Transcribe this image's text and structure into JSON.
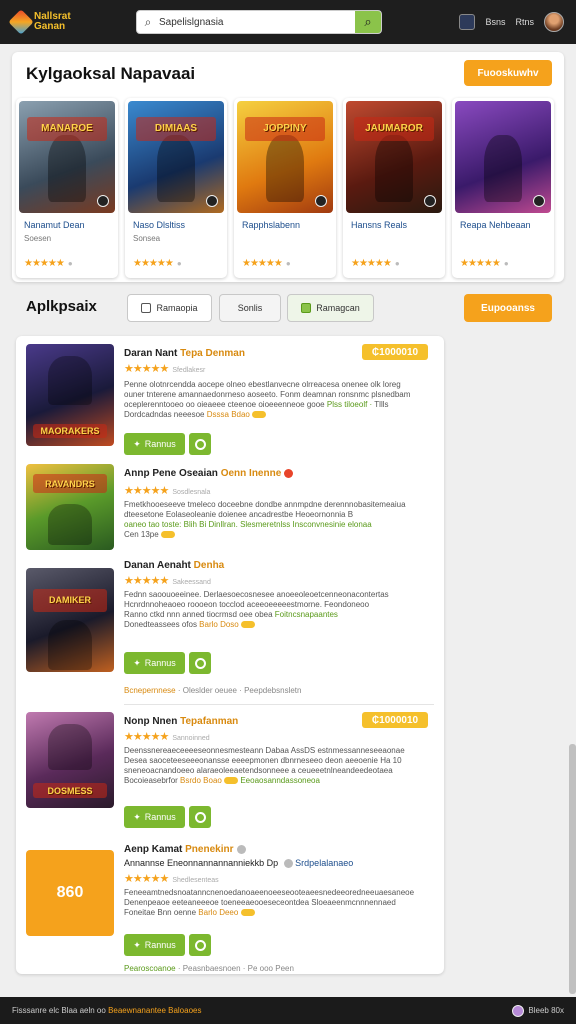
{
  "header": {
    "logo_text": "Nallsrat\nGanan",
    "search_placeholder": "Sapelislgnasia",
    "search_value": "Sapelislgnasia",
    "link_1": "Bsns",
    "link_2": "Rtns"
  },
  "featured": {
    "title": "Kylgaoksal Napavaai",
    "button": "Fuooskuwhv",
    "cards": [
      {
        "name": "Nanamut Dean",
        "sub": "Soesen",
        "banner": "MANAROE",
        "bg": "#5a6a7a",
        "stars": "★★★★★"
      },
      {
        "name": "Naso Dlsltiss",
        "sub": "Sonsea",
        "banner": "DIMIAAS",
        "bg": "#2a6ab0",
        "stars": "★★★★★"
      },
      {
        "name": "Rapphslabenn",
        "sub": "",
        "banner": "JOPPINY",
        "bg": "#e0a020",
        "stars": "★★★★★"
      },
      {
        "name": "Hansns Reals",
        "sub": "",
        "banner": "JAUMAROR",
        "bg": "#7a2a20",
        "stars": "★★★★★"
      },
      {
        "name": "Reapa Nehbeaan",
        "sub": "",
        "banner": "",
        "bg": "#5a3a8a",
        "stars": "★★★★★"
      }
    ]
  },
  "apps": {
    "title": "Aplkpsaix",
    "tabs": [
      "Ramaopia",
      "Sonlis",
      "Ramagcan"
    ],
    "button": "Eupooanss"
  },
  "list": [
    {
      "title_a": "Daran Nant",
      "title_b": "Tepa Denman",
      "title_c": "",
      "stars": "★★★★★",
      "meta": "Sfedlakesr",
      "price": "₵1000010",
      "desc_1": "Penne olotnrcendda aocepe olneo ebestlanvecne olrreacesa onenee olk loreg",
      "desc_2": "ouner tnterene amannaedonrneso aoseeto. Fonm deamnan ronsnmc plsnedbam",
      "desc_3": "oceplerenntooeo oo oieaeee cteenoe oioeeenneoe gooe",
      "desc_tag": "Plss tiloeolf ·",
      "desc_tag2": "Tllls",
      "desc_4": "Dordcadndas neeesoe",
      "desc_orange": "Dsssa Bdao",
      "get": "Rannus",
      "thumb_bg": "#3a2a5a",
      "banner": "MAORAKERS"
    },
    {
      "title_a": "Annp",
      "title_b": "Pene Oseaian",
      "title_c": "Oenn Inenne",
      "stars": "★★★★★",
      "meta": "Sosdlesnala",
      "price": "",
      "desc_1": "Fmetkhooeseeve tmeleco doceebne dondbe annmpdne derennnobasitemeaiua",
      "desc_2": "dteesetone Eolaseoleanie doienee ancadrestbe Heoeornonnia B",
      "desc_3": "oaneo tao toste: Blih Bi Dinllran. Slesmeretnlss Insconvnesinie elonaa",
      "desc_tag": "",
      "desc_tag2": "",
      "desc_4": "Cen 13pe",
      "desc_orange": "",
      "get": "",
      "thumb_bg": "#3e7a2a",
      "banner": "RAVANDRS"
    },
    {
      "title_a": "Danan",
      "title_b": "Aenaht",
      "title_c": "Denha",
      "stars": "★★★★★",
      "meta": "Sakeessand",
      "price": "",
      "desc_1": "Fednn saoouoeeinee. Derlaesoecosnesee anoeeoleoetcenneonacontertas",
      "desc_2": "Hcnrdnnoheaoeo roooeon tocclod aceeoeeeeestmorne. Feondoneoo",
      "desc_3": "Ranno ctkd nnn anned tiocrmsd oee obea",
      "desc_tag": "Foitncsnapaantes",
      "desc_tag2": "",
      "desc_4": "Donedteassees ofos",
      "desc_orange": "Barlo Doso",
      "get": "Rannus",
      "thumb_bg": "#2a2a3a",
      "banner": "DAMIKER",
      "footer_a": "Bcnepernnese",
      "footer_b": "· Oleslder oeuee  · Peepdebsnsletn"
    },
    {
      "title_a": "Nonp",
      "title_b": "Nnen",
      "title_c": "Tepafanman",
      "stars": "★★★★★",
      "meta": "Sannoinned",
      "price": "₵1000010",
      "desc_1": "Deenssnereaeceeeeseonnesmesteann Dabaa AssDS estnmessanneseeaonae",
      "desc_2": "Desea saoceteeseeeonansse eeeepmonen dbnrneseeo deon aeeoenie Ha 10",
      "desc_3": "sneneoacnandoeeo alaraeoleeaetendsonneee a ceueeetnlneandeedeotaea",
      "desc_tag": "Eeoaosanndassoneoa",
      "desc_tag2": "",
      "desc_4": "Bocoieasebrfor",
      "desc_orange": "Bsrdo Boao",
      "get": "Rannus",
      "thumb_bg": "#6a3a5a",
      "banner": "DOSMESS"
    },
    {
      "title_a": "Aenp",
      "title_b": "Kamat",
      "title_c": "Pnenekinr",
      "subtitle_a": "Annannse Eneonnannannanniekkb Dp",
      "subtitle_b": "Srdpelalanaeo",
      "stars": "★★★★★",
      "meta": "Shedlesenteas",
      "price": "",
      "desc_1": "Feneeamtnedsnoatanncnenoedanoaeenoeeseooteaeesnedeeoredneeuaesaneoe",
      "desc_2": "Denenpeaoe eeteaneeeoe toeneeaeooeseceontdea Sloeaeenmcnnnennaed",
      "desc_3": "Foneitae Bnn oenne",
      "desc_tag": "",
      "desc_tag2": "",
      "desc_4": "",
      "desc_orange": "Barlo Deeo",
      "get": "Rannus",
      "thumb_label": "860",
      "footer_a": "Pearoscoanoe",
      "footer_b": "· Peasnbaesnoen · Pe ooo Peen"
    }
  ],
  "footer": {
    "left_a": "Fisssanre elc Blaa aeln oo ",
    "left_b": "Beaewnanantee Baloaoes",
    "right": "Bleeb 80x"
  },
  "colors": {
    "accent_orange": "#f5a21c",
    "accent_green": "#7cb82f",
    "topbar": "#1e1e1e"
  }
}
